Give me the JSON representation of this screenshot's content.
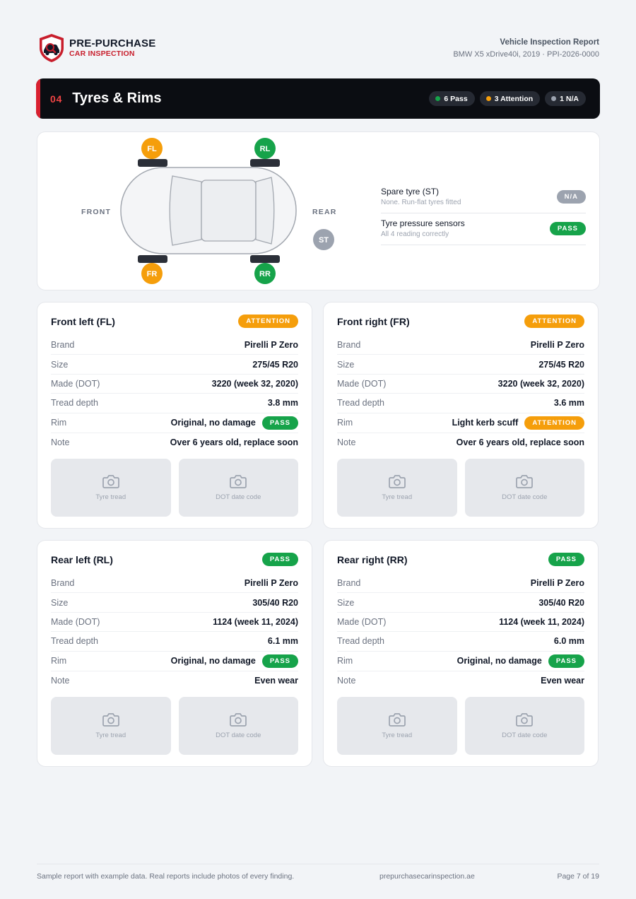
{
  "brand": {
    "line1": "PRE-PURCHASE",
    "line2": "CAR INSPECTION"
  },
  "report": {
    "title": "Vehicle Inspection Report",
    "subtitle": "BMW X5 xDrive40i, 2019 · PPI-2026-0000"
  },
  "section": {
    "number": "04",
    "title": "Tyres & Rims",
    "counts": [
      {
        "label": "6 Pass",
        "color": "#16a34a"
      },
      {
        "label": "3 Attention",
        "color": "#f59e0b"
      },
      {
        "label": "1 N/A",
        "color": "#9ca3af"
      }
    ]
  },
  "diagram": {
    "front_label": "FRONT",
    "rear_label": "REAR",
    "markers": {
      "fl": "FL",
      "rl": "RL",
      "fr": "FR",
      "rr": "RR",
      "st": "ST"
    }
  },
  "side_items": [
    {
      "title": "Spare tyre (ST)",
      "subtitle": "None. Run-flat tyres fitted",
      "status": "N/A"
    },
    {
      "title": "Tyre pressure sensors",
      "subtitle": "All 4 reading correctly",
      "status": "PASS"
    }
  ],
  "tyres": {
    "fl": {
      "title": "Front left (FL)",
      "status": "ATTENTION",
      "rows": [
        {
          "key": "Brand",
          "value": "Pirelli P Zero"
        },
        {
          "key": "Size",
          "value": "275/45 R20"
        },
        {
          "key": "Made (DOT)",
          "value": "3220 (week 32, 2020)"
        },
        {
          "key": "Tread depth",
          "value": "3.8 mm"
        }
      ],
      "rim": {
        "key": "Rim",
        "value": "Original, no damage",
        "status": "PASS"
      },
      "note": {
        "key": "Note",
        "value": "Over 6 years old, replace soon"
      },
      "photos": [
        "Tyre tread",
        "DOT date code"
      ]
    },
    "fr": {
      "title": "Front right (FR)",
      "status": "ATTENTION",
      "rows": [
        {
          "key": "Brand",
          "value": "Pirelli P Zero"
        },
        {
          "key": "Size",
          "value": "275/45 R20"
        },
        {
          "key": "Made (DOT)",
          "value": "3220 (week 32, 2020)"
        },
        {
          "key": "Tread depth",
          "value": "3.6 mm"
        }
      ],
      "rim": {
        "key": "Rim",
        "value": "Light kerb scuff",
        "status": "ATTENTION"
      },
      "note": {
        "key": "Note",
        "value": "Over 6 years old, replace soon"
      },
      "photos": [
        "Tyre tread",
        "DOT date code"
      ]
    },
    "rl": {
      "title": "Rear left (RL)",
      "status": "PASS",
      "rows": [
        {
          "key": "Brand",
          "value": "Pirelli P Zero"
        },
        {
          "key": "Size",
          "value": "305/40 R20"
        },
        {
          "key": "Made (DOT)",
          "value": "1124 (week 11, 2024)"
        },
        {
          "key": "Tread depth",
          "value": "6.1 mm"
        }
      ],
      "rim": {
        "key": "Rim",
        "value": "Original, no damage",
        "status": "PASS"
      },
      "note": {
        "key": "Note",
        "value": "Even wear"
      },
      "photos": [
        "Tyre tread",
        "DOT date code"
      ]
    },
    "rr": {
      "title": "Rear right (RR)",
      "status": "PASS",
      "rows": [
        {
          "key": "Brand",
          "value": "Pirelli P Zero"
        },
        {
          "key": "Size",
          "value": "305/40 R20"
        },
        {
          "key": "Made (DOT)",
          "value": "1124 (week 11, 2024)"
        },
        {
          "key": "Tread depth",
          "value": "6.0 mm"
        }
      ],
      "rim": {
        "key": "Rim",
        "value": "Original, no damage",
        "status": "PASS"
      },
      "note": {
        "key": "Note",
        "value": "Even wear"
      },
      "photos": [
        "Tyre tread",
        "DOT date code"
      ]
    }
  },
  "footer": {
    "disclaimer": "Sample report with example data. Real reports include photos of every finding.",
    "website": "prepurchasecarinspection.ae",
    "page": "Page 7 of 19"
  }
}
